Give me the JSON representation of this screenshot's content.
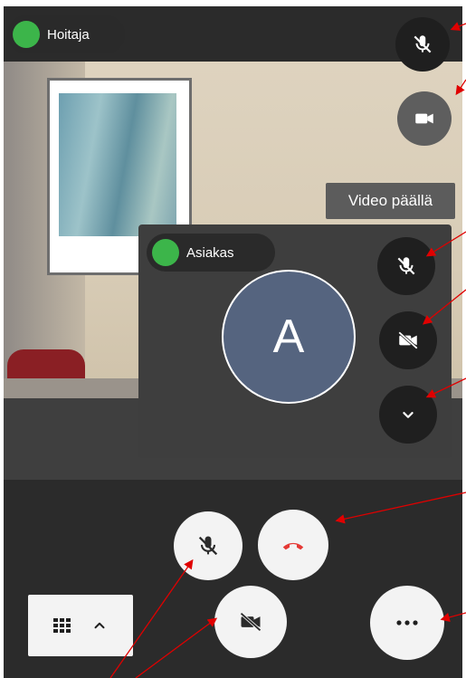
{
  "remote": {
    "name": "Hoitaja",
    "status_color": "#3cb54a"
  },
  "controls": {
    "mic_state": "muted",
    "camera_state": "on",
    "tooltip": "Video päällä"
  },
  "self_view": {
    "name": "Asiakas",
    "avatar_letter": "A",
    "avatar_color": "#55647f",
    "mic_state": "muted",
    "camera_state": "off",
    "expand_icon": "chevron-down-icon"
  },
  "toolbar": {
    "layout_icons": [
      "grid-icon",
      "chevron-up-icon"
    ],
    "mic_state": "muted",
    "camera_state": "off",
    "hangup_color": "#e53935",
    "more_icon": "more-horizontal-icon"
  },
  "colors": {
    "background": "#2b2b2b",
    "annotation": "#e00000"
  }
}
